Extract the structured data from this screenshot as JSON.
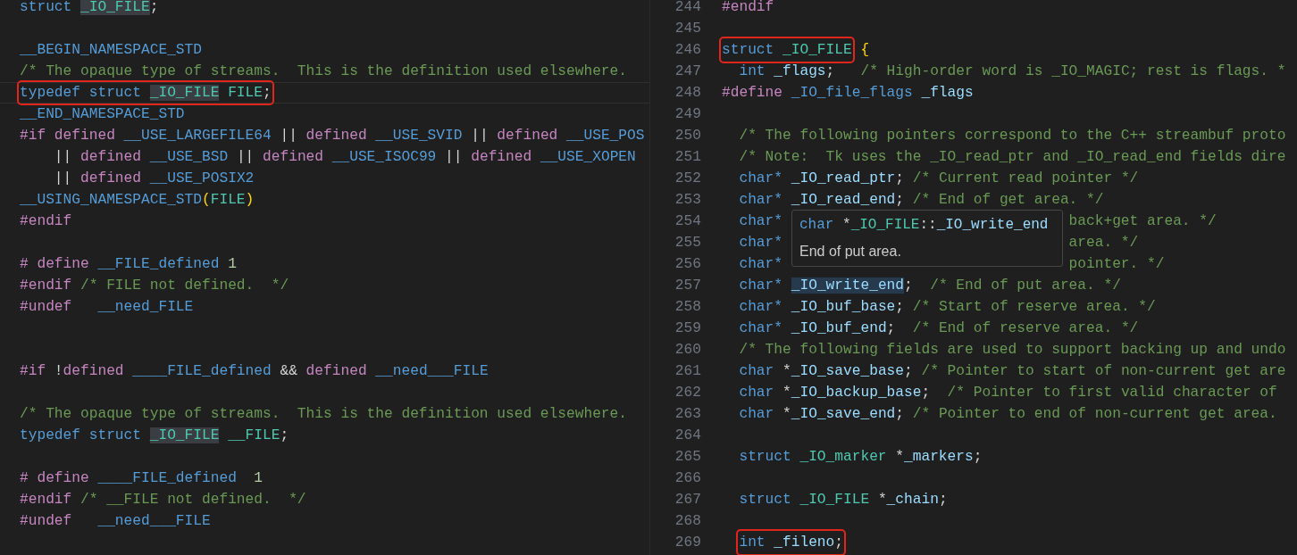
{
  "left_editor": {
    "lines": [
      {
        "kind": "code",
        "tokens": [
          {
            "kind": "keyword",
            "text": "struct "
          },
          {
            "kind": "type",
            "text": "_IO_FILE",
            "highlighted": true
          },
          {
            "kind": "plain",
            "text": ";"
          }
        ]
      },
      {
        "kind": "blank"
      },
      {
        "kind": "code",
        "tokens": [
          {
            "kind": "macro",
            "text": "__BEGIN_NAMESPACE_STD"
          }
        ]
      },
      {
        "kind": "code",
        "tokens": [
          {
            "kind": "comment",
            "text": "/* The opaque type of streams.  This is the definition used elsewhere."
          }
        ]
      },
      {
        "kind": "code",
        "current": true,
        "tokens": [
          {
            "kind": "keyword",
            "text": "typedef struct ",
            "boxed": true
          },
          {
            "kind": "type",
            "text": "_IO_FILE",
            "highlighted": true,
            "boxed": true
          },
          {
            "kind": "type",
            "text": " FILE",
            "boxed": true
          },
          {
            "kind": "plain",
            "text": ";",
            "boxed": true
          }
        ]
      },
      {
        "kind": "code",
        "tokens": [
          {
            "kind": "macro",
            "text": "__END_NAMESPACE_STD"
          }
        ]
      },
      {
        "kind": "code",
        "tokens": [
          {
            "kind": "directive",
            "text": "#if defined "
          },
          {
            "kind": "macro",
            "text": "__USE_LARGEFILE64 "
          },
          {
            "kind": "plain",
            "text": "|| "
          },
          {
            "kind": "directive",
            "text": "defined "
          },
          {
            "kind": "macro",
            "text": "__USE_SVID "
          },
          {
            "kind": "plain",
            "text": "|| "
          },
          {
            "kind": "directive",
            "text": "defined "
          },
          {
            "kind": "macro",
            "text": "__USE_POS"
          }
        ]
      },
      {
        "kind": "code",
        "tokens": [
          {
            "kind": "plain",
            "text": "    || "
          },
          {
            "kind": "directive",
            "text": "defined "
          },
          {
            "kind": "macro",
            "text": "__USE_BSD "
          },
          {
            "kind": "plain",
            "text": "|| "
          },
          {
            "kind": "directive",
            "text": "defined "
          },
          {
            "kind": "macro",
            "text": "__USE_ISOC99 "
          },
          {
            "kind": "plain",
            "text": "|| "
          },
          {
            "kind": "directive",
            "text": "defined "
          },
          {
            "kind": "macro",
            "text": "__USE_XOPEN"
          }
        ]
      },
      {
        "kind": "code",
        "tokens": [
          {
            "kind": "plain",
            "text": "    || "
          },
          {
            "kind": "directive",
            "text": "defined "
          },
          {
            "kind": "macro",
            "text": "__USE_POSIX2"
          }
        ]
      },
      {
        "kind": "code",
        "tokens": [
          {
            "kind": "macro",
            "text": "__USING_NAMESPACE_STD"
          },
          {
            "kind": "bracket",
            "text": "("
          },
          {
            "kind": "type",
            "text": "FILE"
          },
          {
            "kind": "bracket",
            "text": ")"
          }
        ]
      },
      {
        "kind": "code",
        "tokens": [
          {
            "kind": "directive",
            "text": "#endif"
          }
        ]
      },
      {
        "kind": "blank"
      },
      {
        "kind": "code",
        "tokens": [
          {
            "kind": "directive",
            "text": "# define "
          },
          {
            "kind": "macro",
            "text": "__FILE_defined "
          },
          {
            "kind": "number",
            "text": "1"
          }
        ]
      },
      {
        "kind": "code",
        "tokens": [
          {
            "kind": "directive",
            "text": "#endif "
          },
          {
            "kind": "comment",
            "text": "/* FILE not defined.  */"
          }
        ]
      },
      {
        "kind": "code",
        "tokens": [
          {
            "kind": "directive",
            "text": "#undef   "
          },
          {
            "kind": "macro",
            "text": "__need_FILE"
          }
        ]
      },
      {
        "kind": "blank"
      },
      {
        "kind": "blank"
      },
      {
        "kind": "code",
        "tokens": [
          {
            "kind": "directive",
            "text": "#if "
          },
          {
            "kind": "plain",
            "text": "!"
          },
          {
            "kind": "directive",
            "text": "defined "
          },
          {
            "kind": "macro",
            "text": "____FILE_defined "
          },
          {
            "kind": "plain",
            "text": "&& "
          },
          {
            "kind": "directive",
            "text": "defined "
          },
          {
            "kind": "macro",
            "text": "__need___FILE"
          }
        ]
      },
      {
        "kind": "blank"
      },
      {
        "kind": "code",
        "tokens": [
          {
            "kind": "comment",
            "text": "/* The opaque type of streams.  This is the definition used elsewhere."
          }
        ]
      },
      {
        "kind": "code",
        "tokens": [
          {
            "kind": "keyword",
            "text": "typedef struct "
          },
          {
            "kind": "type",
            "text": "_IO_FILE",
            "highlighted": true
          },
          {
            "kind": "type",
            "text": " __FILE"
          },
          {
            "kind": "plain",
            "text": ";"
          }
        ]
      },
      {
        "kind": "blank"
      },
      {
        "kind": "code",
        "tokens": [
          {
            "kind": "directive",
            "text": "# define "
          },
          {
            "kind": "macro",
            "text": "____FILE_defined  "
          },
          {
            "kind": "number",
            "text": "1"
          }
        ]
      },
      {
        "kind": "code",
        "tokens": [
          {
            "kind": "directive",
            "text": "#endif "
          },
          {
            "kind": "comment",
            "text": "/* __FILE not defined.  */"
          }
        ]
      },
      {
        "kind": "code",
        "tokens": [
          {
            "kind": "directive",
            "text": "#undef   "
          },
          {
            "kind": "macro",
            "text": "__need___FILE"
          }
        ]
      }
    ]
  },
  "right_editor": {
    "lines": [
      {
        "kind": "code",
        "number": "244",
        "tokens": [
          {
            "kind": "directive",
            "text": "#endif"
          }
        ]
      },
      {
        "kind": "blank",
        "number": "245"
      },
      {
        "kind": "code",
        "number": "246",
        "tokens": [
          {
            "kind": "keyword",
            "text": "struct ",
            "boxed": true
          },
          {
            "kind": "type",
            "text": "_IO_FILE",
            "boxed": true
          },
          {
            "kind": "bracket",
            "text": " {"
          }
        ]
      },
      {
        "kind": "code",
        "number": "247",
        "tokens": [
          {
            "kind": "keyword",
            "text": "  int "
          },
          {
            "kind": "variable",
            "text": "_flags"
          },
          {
            "kind": "plain",
            "text": ";   "
          },
          {
            "kind": "comment",
            "text": "/* High-order word is _IO_MAGIC; rest is flags. *"
          }
        ]
      },
      {
        "kind": "code",
        "number": "248",
        "tokens": [
          {
            "kind": "directive",
            "text": "#define "
          },
          {
            "kind": "macro",
            "text": "_IO_file_flags "
          },
          {
            "kind": "variable",
            "text": "_flags"
          }
        ]
      },
      {
        "kind": "blank",
        "number": "249"
      },
      {
        "kind": "code",
        "number": "250",
        "tokens": [
          {
            "kind": "comment",
            "text": "  /* The following pointers correspond to the C++ streambuf proto"
          }
        ]
      },
      {
        "kind": "code",
        "number": "251",
        "tokens": [
          {
            "kind": "comment",
            "text": "  /* Note:  Tk uses the _IO_read_ptr and _IO_read_end fields dire"
          }
        ]
      },
      {
        "kind": "code",
        "number": "252",
        "tokens": [
          {
            "kind": "keyword",
            "text": "  char* "
          },
          {
            "kind": "variable",
            "text": "_IO_read_ptr"
          },
          {
            "kind": "plain",
            "text": "; "
          },
          {
            "kind": "comment",
            "text": "/* Current read pointer */"
          }
        ]
      },
      {
        "kind": "code",
        "number": "253",
        "tokens": [
          {
            "kind": "keyword",
            "text": "  char* "
          },
          {
            "kind": "variable",
            "text": "_IO_read_end"
          },
          {
            "kind": "plain",
            "text": "; "
          },
          {
            "kind": "comment",
            "text": "/* End of get area. */"
          }
        ]
      },
      {
        "kind": "code",
        "number": "254",
        "under_tooltip": true,
        "tokens": [
          {
            "kind": "keyword",
            "text": "  char*"
          },
          {
            "kind": "comment",
            "text": "back+get area. */"
          }
        ]
      },
      {
        "kind": "code",
        "number": "255",
        "under_tooltip": true,
        "tokens": [
          {
            "kind": "keyword",
            "text": "  char*"
          },
          {
            "kind": "comment",
            "text": "area. */"
          }
        ]
      },
      {
        "kind": "code",
        "number": "256",
        "under_tooltip": true,
        "tokens": [
          {
            "kind": "keyword",
            "text": "  char*"
          },
          {
            "kind": "comment",
            "text": "pointer. */"
          }
        ]
      },
      {
        "kind": "code",
        "number": "257",
        "tokens": [
          {
            "kind": "keyword",
            "text": "  char* "
          },
          {
            "kind": "variable",
            "text": "_IO_write_end",
            "hovered": true
          },
          {
            "kind": "plain",
            "text": ";  "
          },
          {
            "kind": "comment",
            "text": "/* End of put area. */"
          }
        ]
      },
      {
        "kind": "code",
        "number": "258",
        "tokens": [
          {
            "kind": "keyword",
            "text": "  char* "
          },
          {
            "kind": "variable",
            "text": "_IO_buf_base"
          },
          {
            "kind": "plain",
            "text": "; "
          },
          {
            "kind": "comment",
            "text": "/* Start of reserve area. */"
          }
        ]
      },
      {
        "kind": "code",
        "number": "259",
        "tokens": [
          {
            "kind": "keyword",
            "text": "  char* "
          },
          {
            "kind": "variable",
            "text": "_IO_buf_end"
          },
          {
            "kind": "plain",
            "text": ";  "
          },
          {
            "kind": "comment",
            "text": "/* End of reserve area. */"
          }
        ]
      },
      {
        "kind": "code",
        "number": "260",
        "tokens": [
          {
            "kind": "comment",
            "text": "  /* The following fields are used to support backing up and undo"
          }
        ]
      },
      {
        "kind": "code",
        "number": "261",
        "tokens": [
          {
            "kind": "keyword",
            "text": "  char "
          },
          {
            "kind": "plain",
            "text": "*"
          },
          {
            "kind": "variable",
            "text": "_IO_save_base"
          },
          {
            "kind": "plain",
            "text": "; "
          },
          {
            "kind": "comment",
            "text": "/* Pointer to start of non-current get are"
          }
        ]
      },
      {
        "kind": "code",
        "number": "262",
        "tokens": [
          {
            "kind": "keyword",
            "text": "  char "
          },
          {
            "kind": "plain",
            "text": "*"
          },
          {
            "kind": "variable",
            "text": "_IO_backup_base"
          },
          {
            "kind": "plain",
            "text": ";  "
          },
          {
            "kind": "comment",
            "text": "/* Pointer to first valid character of"
          }
        ]
      },
      {
        "kind": "code",
        "number": "263",
        "tokens": [
          {
            "kind": "keyword",
            "text": "  char "
          },
          {
            "kind": "plain",
            "text": "*"
          },
          {
            "kind": "variable",
            "text": "_IO_save_end"
          },
          {
            "kind": "plain",
            "text": "; "
          },
          {
            "kind": "comment",
            "text": "/* Pointer to end of non-current get area."
          }
        ]
      },
      {
        "kind": "blank",
        "number": "264"
      },
      {
        "kind": "code",
        "number": "265",
        "tokens": [
          {
            "kind": "keyword",
            "text": "  struct "
          },
          {
            "kind": "type",
            "text": "_IO_marker "
          },
          {
            "kind": "plain",
            "text": "*"
          },
          {
            "kind": "variable",
            "text": "_markers"
          },
          {
            "kind": "plain",
            "text": ";"
          }
        ]
      },
      {
        "kind": "blank",
        "number": "266"
      },
      {
        "kind": "code",
        "number": "267",
        "tokens": [
          {
            "kind": "keyword",
            "text": "  struct "
          },
          {
            "kind": "type",
            "text": "_IO_FILE "
          },
          {
            "kind": "plain",
            "text": "*"
          },
          {
            "kind": "variable",
            "text": "_chain"
          },
          {
            "kind": "plain",
            "text": ";"
          }
        ]
      },
      {
        "kind": "blank",
        "number": "268"
      },
      {
        "kind": "code",
        "number": "269",
        "tokens": [
          {
            "kind": "keyword",
            "text": "  int ",
            "boxed": true
          },
          {
            "kind": "variable",
            "text": "_fileno",
            "boxed": true
          },
          {
            "kind": "plain",
            "text": ";",
            "boxed": true
          }
        ]
      }
    ],
    "tooltip": {
      "signature": [
        {
          "kind": "keyword",
          "text": "char "
        },
        {
          "kind": "plain",
          "text": "*"
        },
        {
          "kind": "type",
          "text": "_IO_FILE"
        },
        {
          "kind": "plain",
          "text": "::"
        },
        {
          "kind": "variable",
          "text": "_IO_write_end"
        }
      ],
      "doc": "End of put area."
    }
  }
}
